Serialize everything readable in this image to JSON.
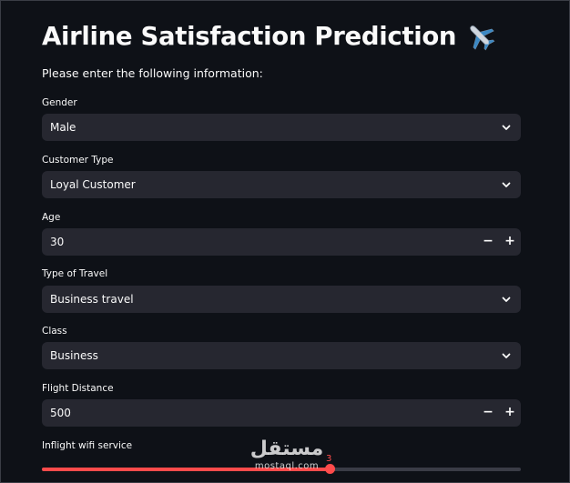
{
  "page": {
    "title": "Airline Satisfaction Prediction",
    "title_icon": "airplane-icon",
    "intro": "Please enter the following information:"
  },
  "fields": {
    "gender": {
      "label": "Gender",
      "value": "Male",
      "type": "select"
    },
    "customer_type": {
      "label": "Customer Type",
      "value": "Loyal Customer",
      "type": "select"
    },
    "age": {
      "label": "Age",
      "value": "30",
      "type": "number",
      "minus": "−",
      "plus": "+"
    },
    "travel_type": {
      "label": "Type of Travel",
      "value": "Business travel",
      "type": "select"
    },
    "class": {
      "label": "Class",
      "value": "Business",
      "type": "select"
    },
    "flight_distance": {
      "label": "Flight Distance",
      "value": "500",
      "type": "number",
      "minus": "−",
      "plus": "+"
    },
    "wifi": {
      "label": "Inflight wifi service",
      "value": "3",
      "type": "slider",
      "min": 0,
      "max": 5
    }
  },
  "watermark": {
    "arabic": "مستقل",
    "latin": "mostaql.com"
  },
  "colors": {
    "background": "#0e1117",
    "field_bg": "#262730",
    "text": "#fafafa",
    "accent": "#ff4b4b"
  }
}
